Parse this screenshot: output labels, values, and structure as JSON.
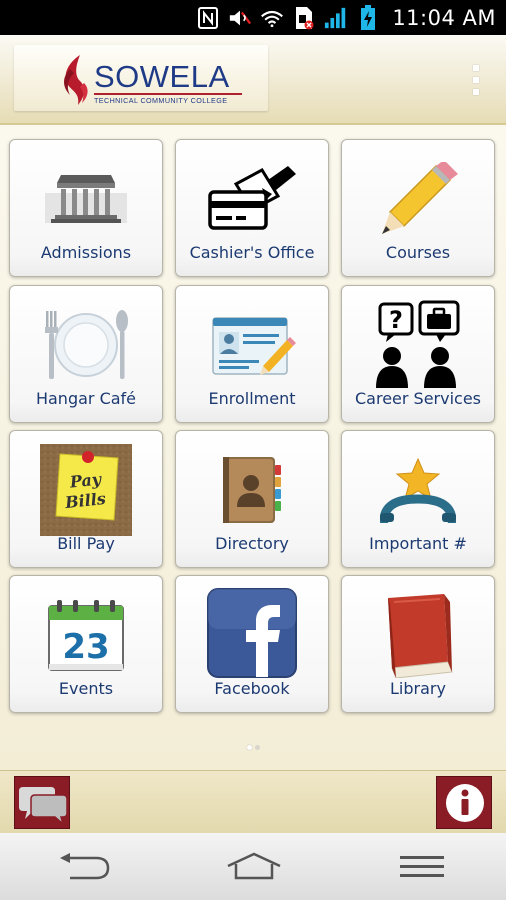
{
  "status_bar": {
    "time": "11:04 AM",
    "icons": [
      "nfc-icon",
      "mute-icon",
      "wifi-icon",
      "sim-icon",
      "signal-icon",
      "battery-charging-icon"
    ]
  },
  "header": {
    "logo_text": "SOWELA",
    "logo_subtext": "TECHNICAL COMMUNITY COLLEGE",
    "menu_icon": "overflow-menu-icon"
  },
  "tiles": [
    {
      "label": "Admissions",
      "icon": "building-icon"
    },
    {
      "label": "Cashier's Office",
      "icon": "card-payment-icon"
    },
    {
      "label": "Courses",
      "icon": "pencil-icon"
    },
    {
      "label": "Hangar Café",
      "icon": "plate-cutlery-icon"
    },
    {
      "label": "Enrollment",
      "icon": "id-form-icon"
    },
    {
      "label": "Career Services",
      "icon": "career-people-icon"
    },
    {
      "label": "Bill Pay",
      "icon": "sticky-note-icon",
      "note_text": [
        "Pay",
        "Bills"
      ]
    },
    {
      "label": "Directory",
      "icon": "address-book-icon"
    },
    {
      "label": "Important #",
      "icon": "star-phone-icon"
    },
    {
      "label": "Events",
      "icon": "calendar-icon",
      "calendar_day": "23"
    },
    {
      "label": "Facebook",
      "icon": "facebook-icon"
    },
    {
      "label": "Library",
      "icon": "book-icon"
    }
  ],
  "pager": {
    "pages": 2,
    "current": 1
  },
  "bottom_bar": {
    "left_icon": "chat-bubbles-icon",
    "right_icon": "info-icon"
  },
  "nav_bar": {
    "icons": [
      "back-icon",
      "home-icon",
      "menu-icon"
    ]
  },
  "colors": {
    "brand_navy": "#1f3a86",
    "brand_maroon": "#8a1c26",
    "label_color": "#1c3a72",
    "header_tan": "#e6dcb5"
  }
}
